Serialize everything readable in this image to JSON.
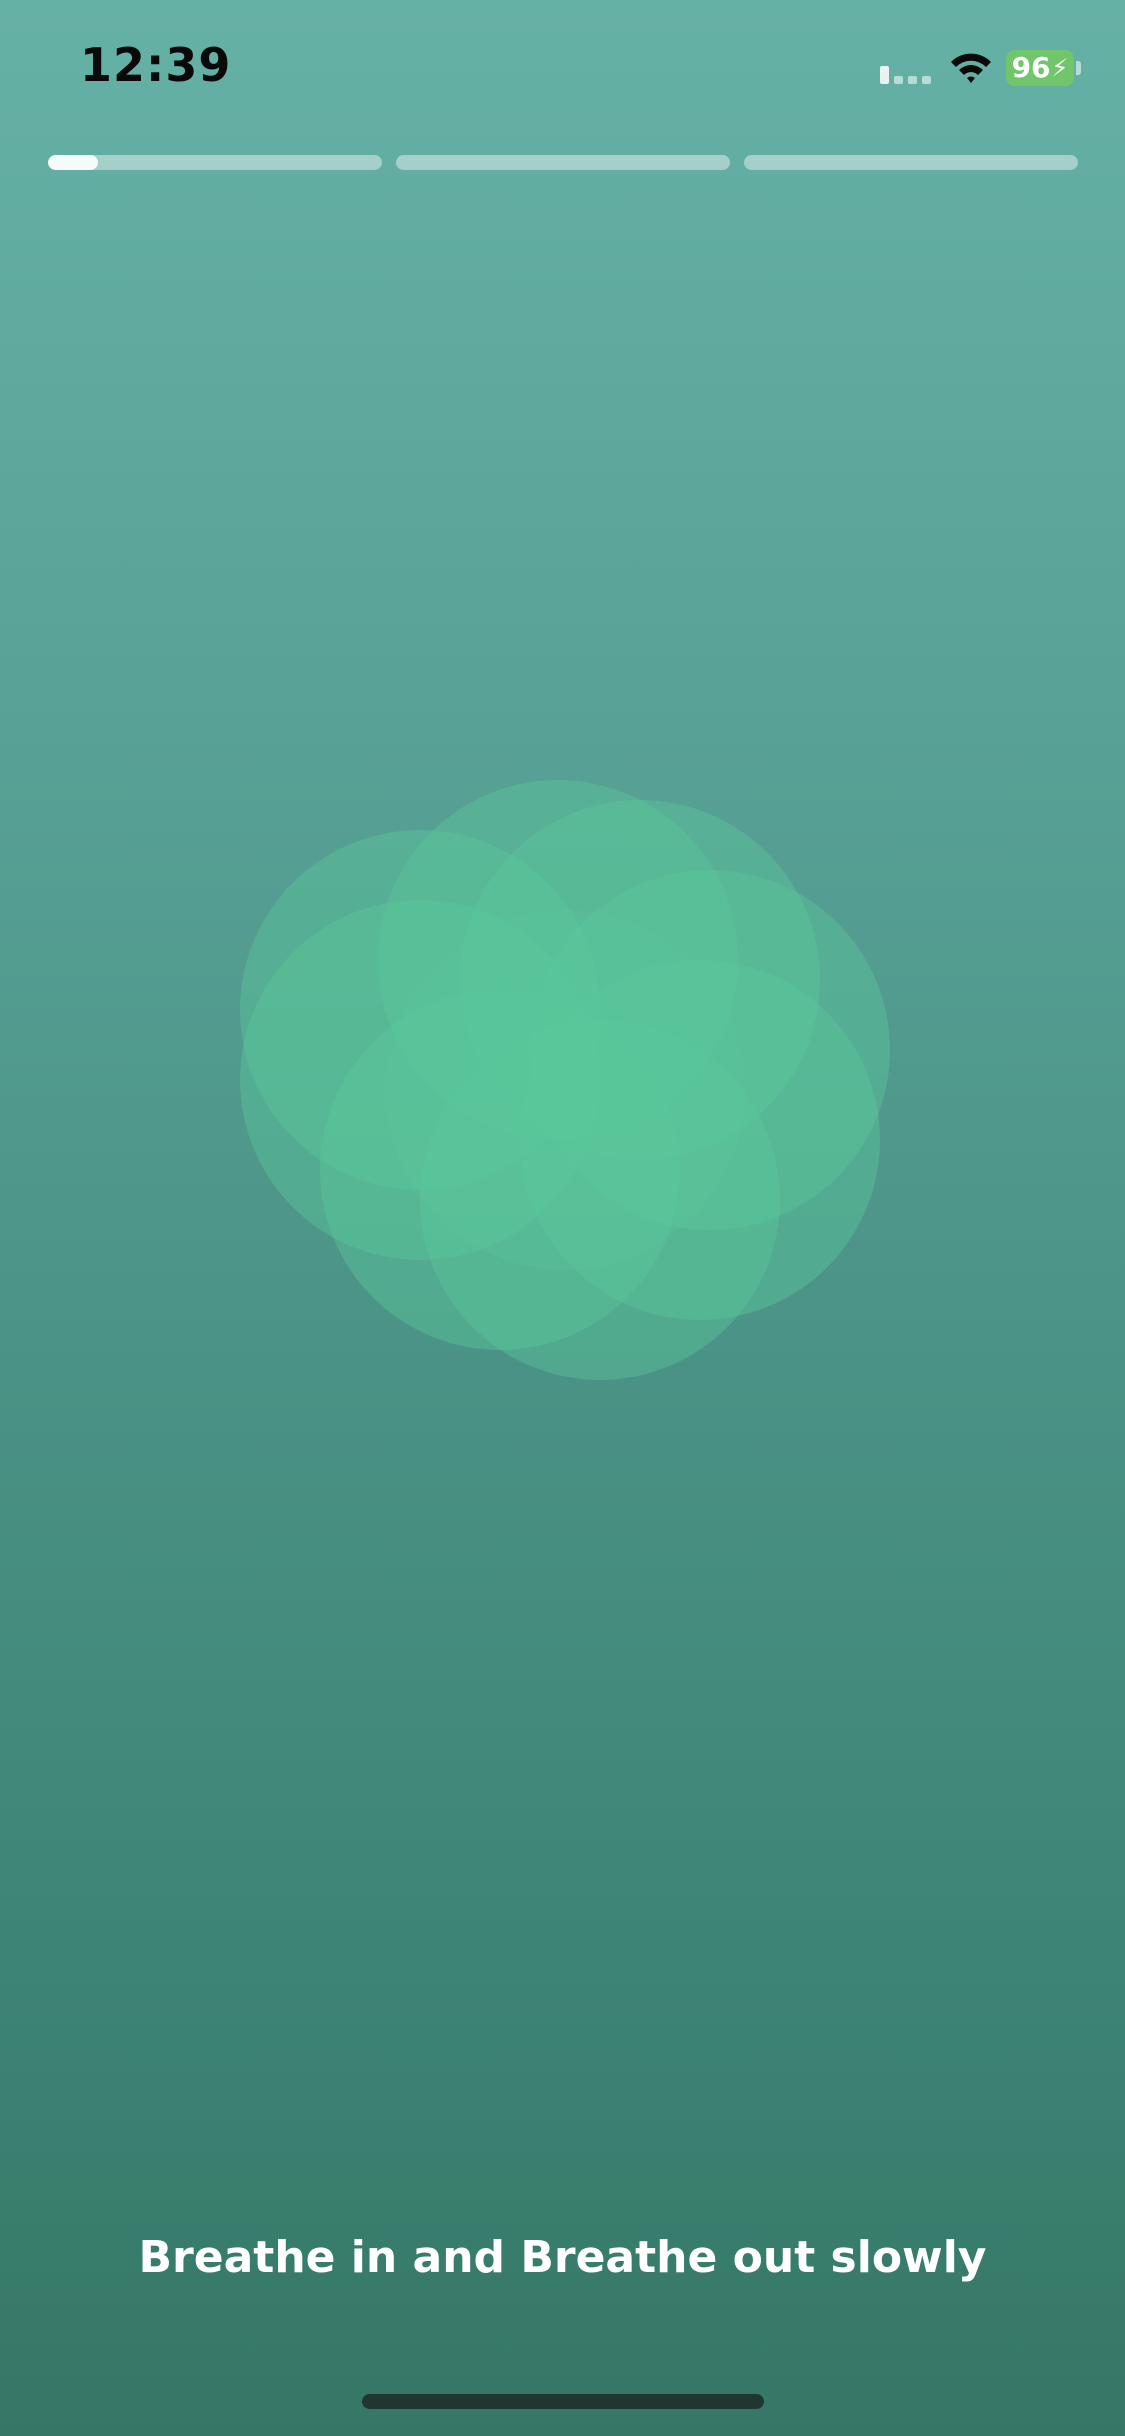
{
  "status_bar": {
    "time": "12:39",
    "battery_percent": "96",
    "charging": true,
    "signal_icon": "cellular-signal-icon",
    "wifi_icon": "wifi-icon"
  },
  "progress": {
    "segments": [
      {
        "fill": 0.15
      },
      {
        "fill": 0.0
      },
      {
        "fill": 0.0
      }
    ]
  },
  "breathing": {
    "caption": "Breathe in and Breathe out slowly",
    "shape_icon": "breathing-flower"
  },
  "colors": {
    "background_top": "#66b1a6",
    "background_bottom": "#357767",
    "petal": "#5ac89b",
    "battery": "#71c66c"
  }
}
